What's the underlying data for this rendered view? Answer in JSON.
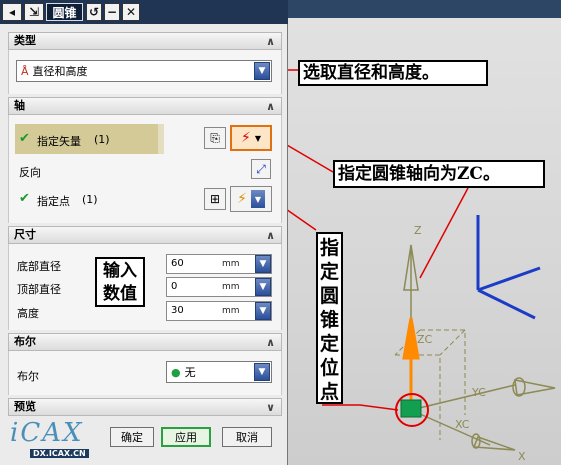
{
  "title": "圆锥",
  "titlebar": {
    "pin": "⇲",
    "reset": "↺",
    "minimize": "−",
    "close": "✕"
  },
  "sections": {
    "type": "类型",
    "axis": "轴",
    "dimensions": "尺寸",
    "boolean": "布尔",
    "preview": "预览"
  },
  "type_select": {
    "value": "直径和高度"
  },
  "axis": {
    "vector_label": "指定矢量",
    "vector_count": "(1)",
    "reverse_label": "反向",
    "point_label": "指定点",
    "point_count": "(1)"
  },
  "dimensions": {
    "base_diameter_label": "底部直径",
    "base_diameter_value": "60",
    "top_diameter_label": "顶部直径",
    "top_diameter_value": "0",
    "height_label": "高度",
    "height_value": "30",
    "unit": "mm"
  },
  "boolean": {
    "label": "布尔",
    "value": "无"
  },
  "buttons": {
    "ok": "确定",
    "apply": "应用",
    "cancel": "取消"
  },
  "watermark": {
    "logo": "iCAX",
    "url": "DX.ICAX.CN"
  },
  "annotations": {
    "select_type": "选取直径和高度。",
    "axis_dir": "指定圆锥轴向为ZC。",
    "enter_values": "输入数值",
    "position_point": "指定圆锥定位点"
  },
  "viewport": {
    "axis_z": "Z",
    "axis_zc": "ZC",
    "axis_yc": "YC",
    "axis_xc": "XC",
    "axis_x": "X"
  },
  "colors": {
    "callout_line": "#e00000",
    "axis_olive": "#8c8a55",
    "triad_blue": "#1c3cc8",
    "origin_green": "#12a050",
    "vector_orange": "#ff8a00"
  }
}
